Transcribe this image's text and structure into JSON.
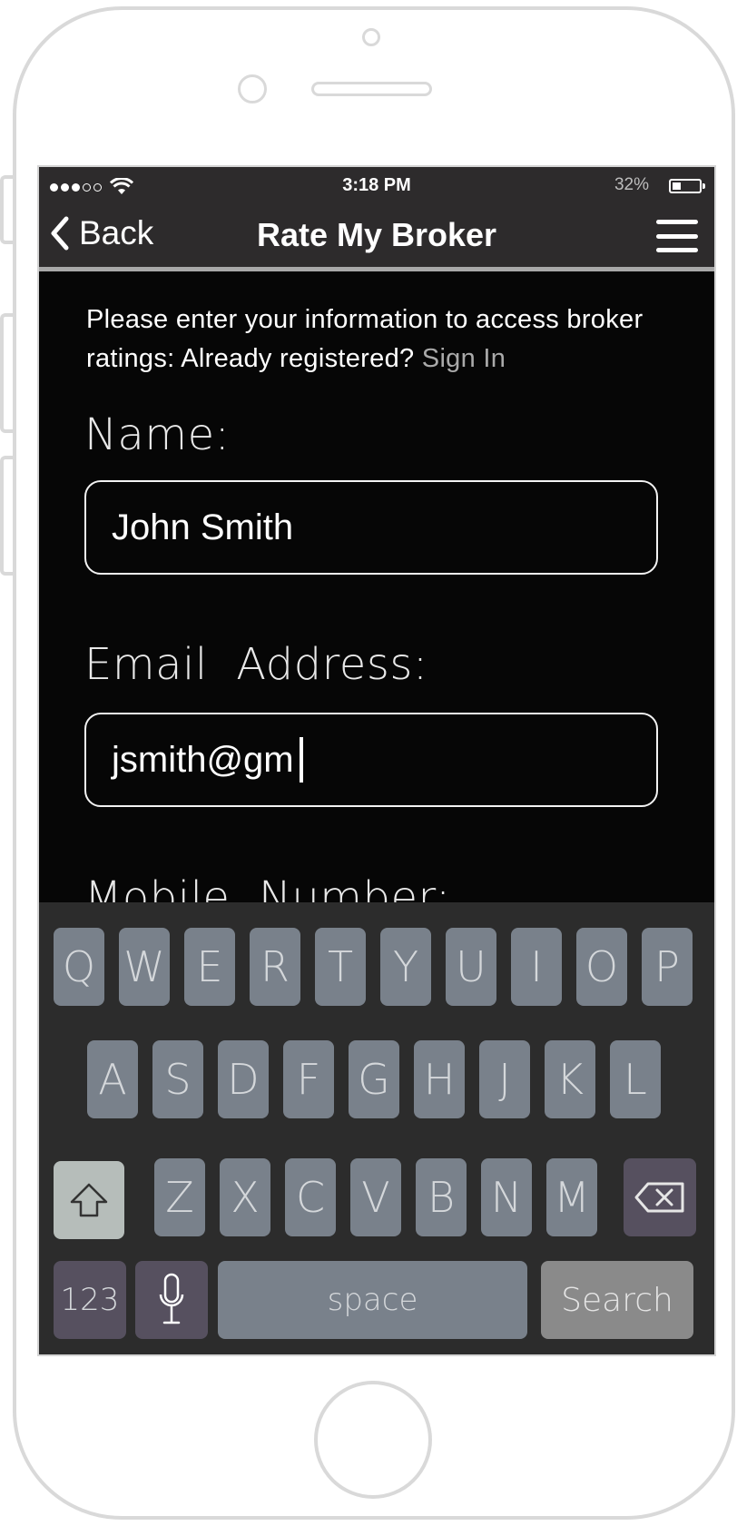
{
  "status_bar": {
    "time": "3:18 PM",
    "battery_percent": "32%",
    "battery_level": 0.32,
    "signal_bars": 3,
    "signal_total": 5
  },
  "nav": {
    "back_label": "Back",
    "title": "Rate My Broker",
    "menu_icon": "hamburger-menu-icon"
  },
  "form": {
    "intro_text": "Please enter your information to access broker ratings: Already registered?",
    "sign_in_link": "Sign In",
    "name_label": "Name:",
    "name_value": "John Smith",
    "email_label": "Email  Address:",
    "email_value": "jsmith@gm",
    "mobile_label": "Mobile  Number:"
  },
  "keyboard": {
    "row1": [
      "Q",
      "W",
      "E",
      "R",
      "T",
      "Y",
      "U",
      "I",
      "O",
      "P"
    ],
    "row2": [
      "A",
      "S",
      "D",
      "F",
      "G",
      "H",
      "J",
      "K",
      "L"
    ],
    "row3": [
      "Z",
      "X",
      "C",
      "V",
      "B",
      "N",
      "M"
    ],
    "numbers_key": "123",
    "space_key": "space",
    "search_key": "Search",
    "shift_icon": "shift-arrow-icon",
    "delete_icon": "delete-backspace-icon",
    "mic_icon": "microphone-icon"
  },
  "colors": {
    "screen_bg": "#060606",
    "bar_bg": "#2d2b2c",
    "key_bg": "#79818b",
    "special_key_bg": "#56505f",
    "link": "#a9a9a9"
  }
}
